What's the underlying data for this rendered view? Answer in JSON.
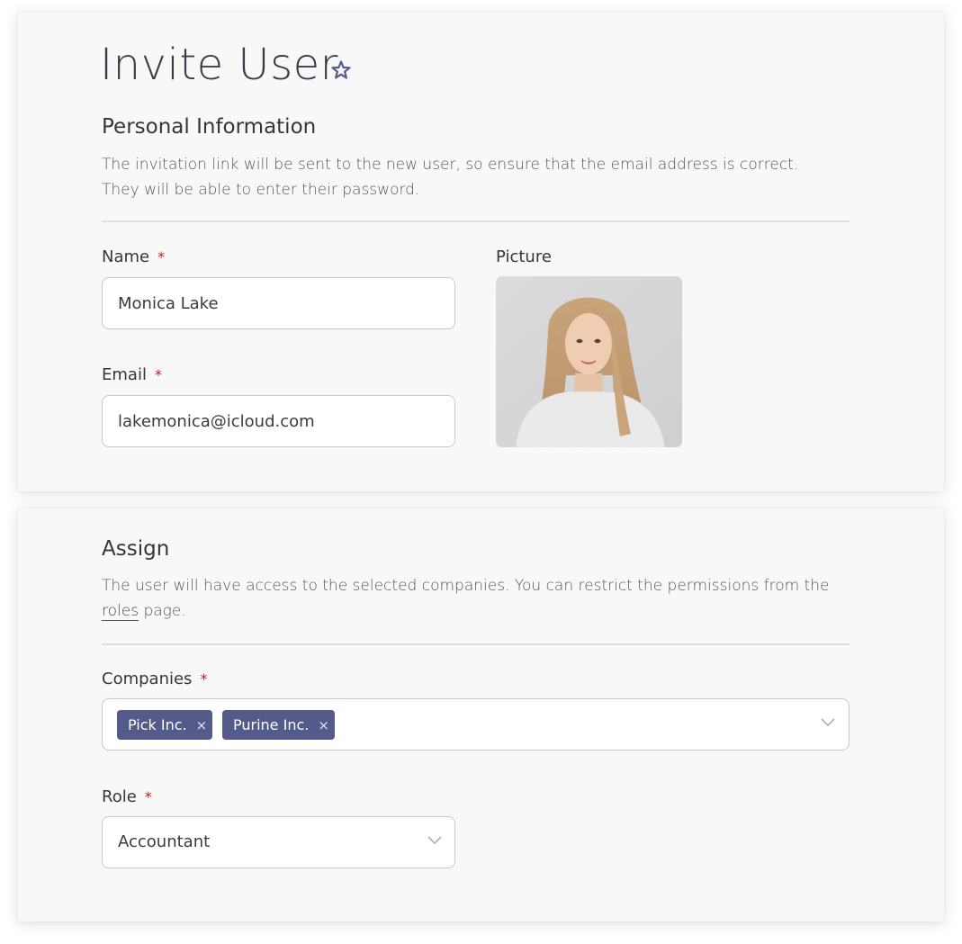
{
  "header": {
    "title": "Invite User",
    "favorite_icon": "star-outline-icon"
  },
  "personal": {
    "title": "Personal Information",
    "description_line1": "The invitation link will be sent to the new user, so ensure that the email address is correct.",
    "description_line2": "They will be able to enter their password.",
    "name_label": "Name",
    "name_value": "Monica Lake",
    "email_label": "Email",
    "email_value": "lakemonica@icloud.com",
    "picture_label": "Picture",
    "required_mark": "*"
  },
  "assign": {
    "title": "Assign",
    "description_before_link": "The user will have access to the selected companies. You can restrict the permissions from the ",
    "link_text": "roles",
    "description_after_link": " page.",
    "companies_label": "Companies",
    "companies_selected": [
      "Pick Inc.",
      "Purine Inc."
    ],
    "tag_remove_symbol": "×",
    "role_label": "Role",
    "role_value": "Accountant",
    "required_mark": "*"
  },
  "colors": {
    "accent": "#545a8a",
    "required": "#c0231f",
    "card_background": "#f8f8f9",
    "input_border": "#c6c6d6"
  }
}
